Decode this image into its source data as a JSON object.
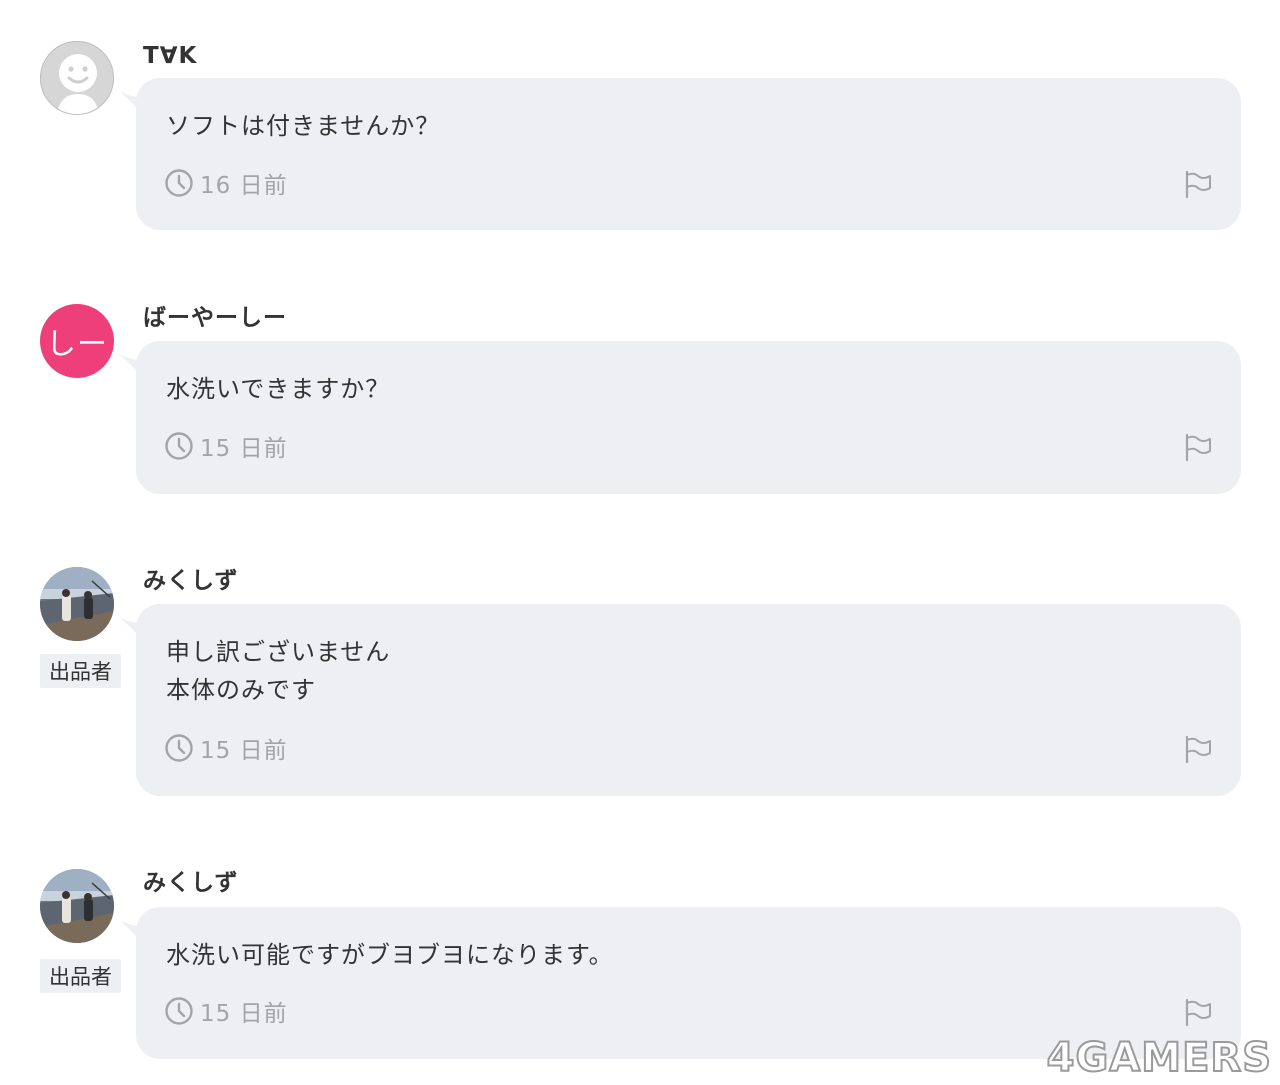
{
  "comments": [
    {
      "user": "T∀K",
      "avatar": {
        "kind": "default",
        "icon": "default-user-avatar"
      },
      "seller_badge": null,
      "message": "ソフトは付きませんか？",
      "time": "16 日前"
    },
    {
      "user": "ばーやーしー",
      "avatar": {
        "kind": "initials",
        "text": "しー",
        "color": "#ee3f7a"
      },
      "seller_badge": null,
      "message": "水洗いできますか？",
      "time": "15 日前"
    },
    {
      "user": "みくしず",
      "avatar": {
        "kind": "photo",
        "icon": "user-photo-avatar"
      },
      "seller_badge": "出品者",
      "message": "申し訳ございません\n本体のみです",
      "time": "15 日前"
    },
    {
      "user": "みくしず",
      "avatar": {
        "kind": "photo",
        "icon": "user-photo-avatar"
      },
      "seller_badge": "出品者",
      "message": "水洗い可能ですがブヨブヨになります。",
      "time": "15 日前"
    }
  ],
  "icons": {
    "time": "clock-icon",
    "report": "flag-icon"
  },
  "colors": {
    "bubble": "#eeeff3",
    "meta_text": "#a4a4a4",
    "initials_avatar": "#ee3f7a"
  },
  "watermark": "4GAMERS"
}
